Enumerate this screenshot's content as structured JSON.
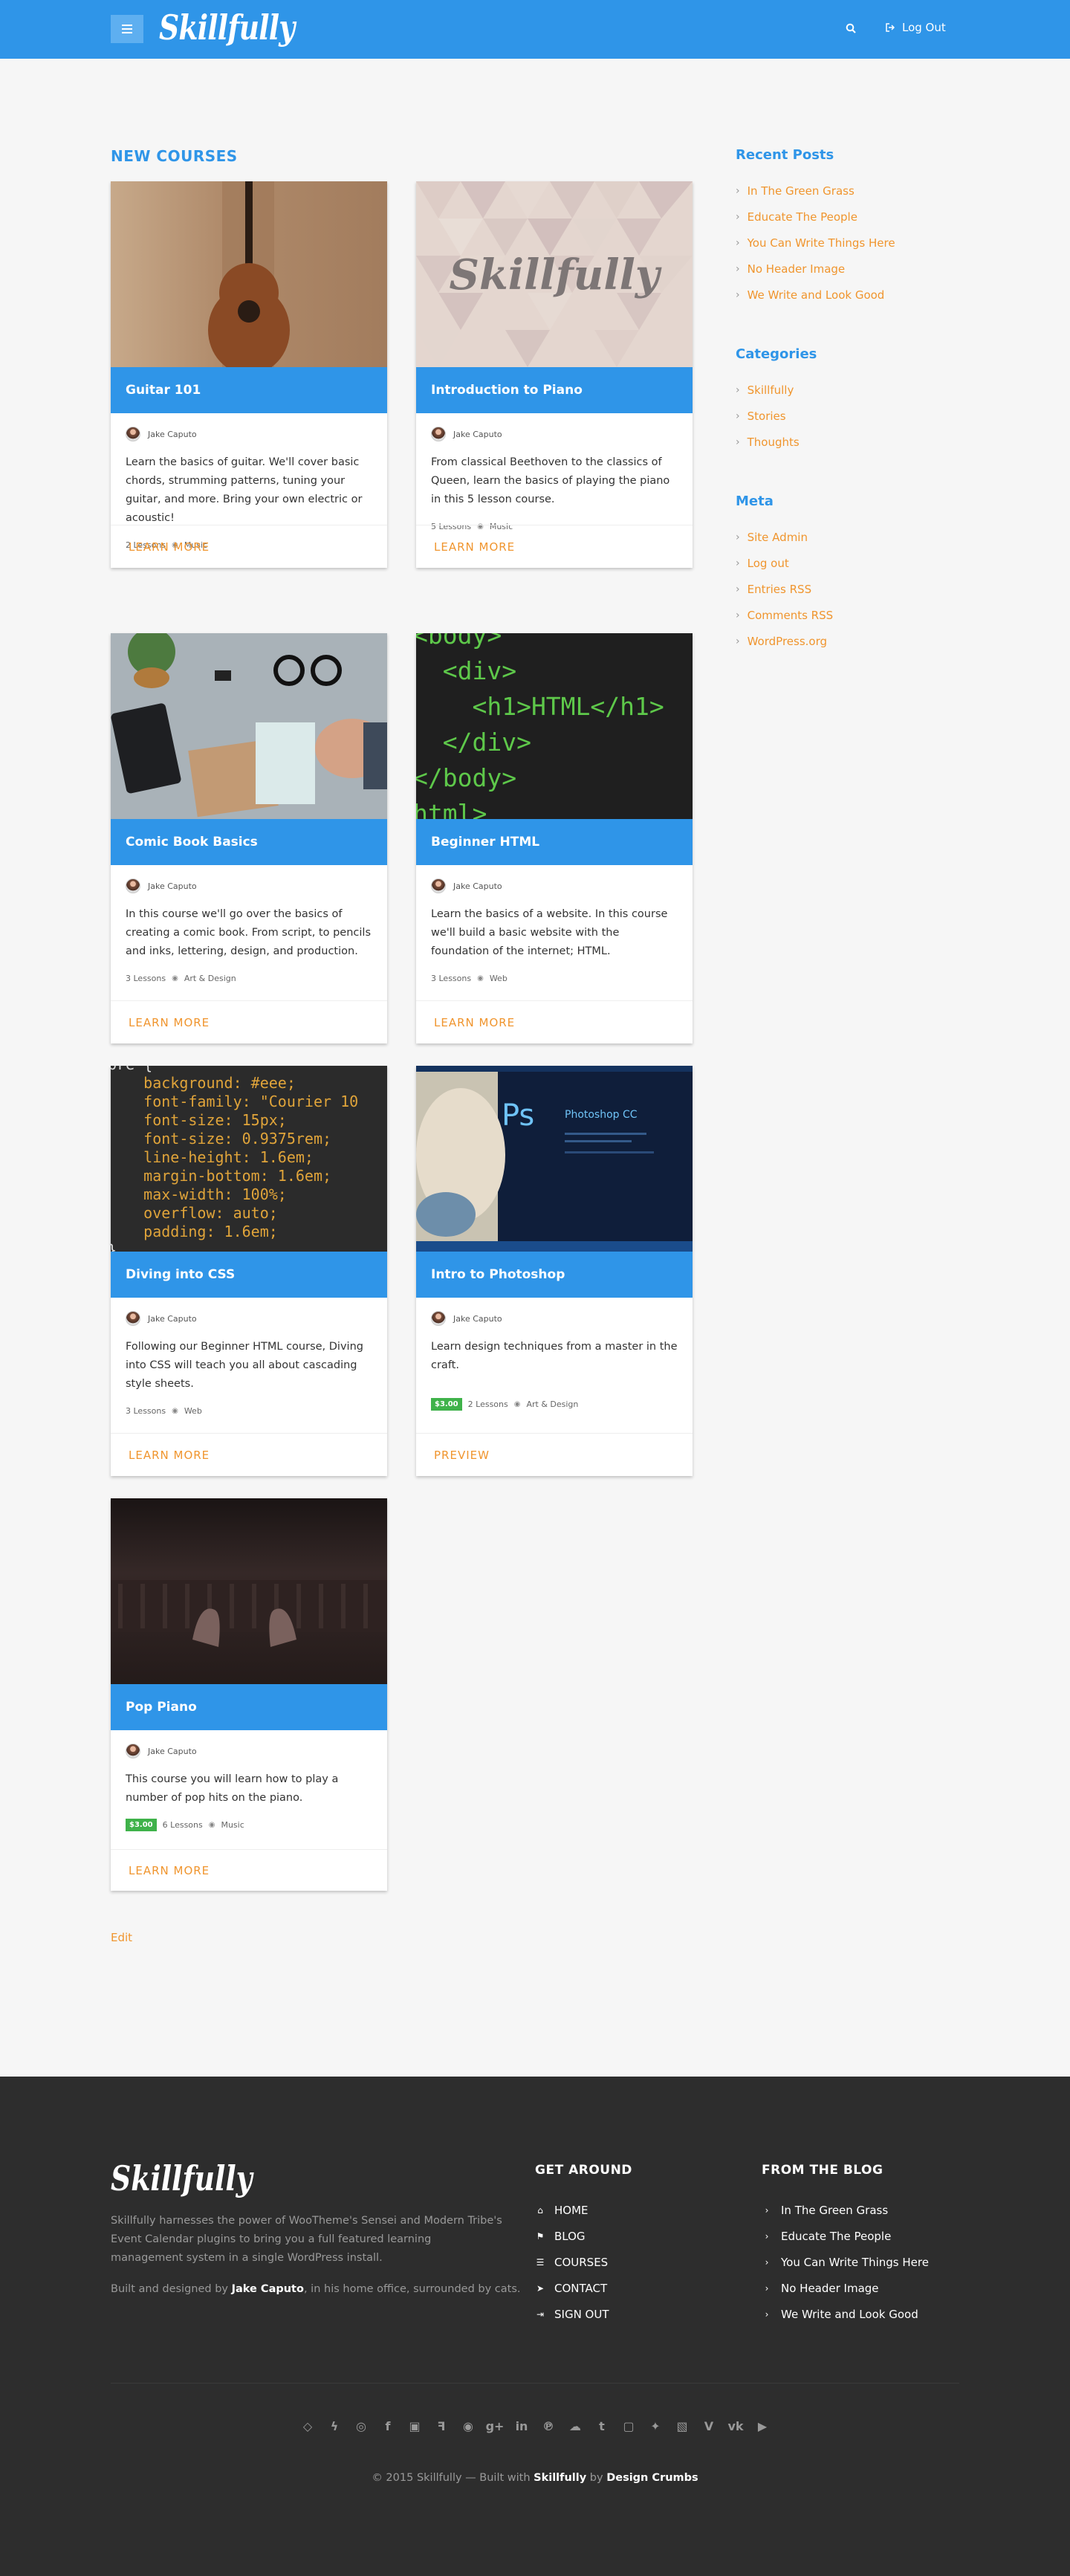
{
  "header": {
    "brand": "Skillfully",
    "logout_label": "Log Out",
    "colors": {
      "bar": "#2f95e8",
      "accent": "#f0952e"
    }
  },
  "main": {
    "section_title": "NEW COURSES",
    "cta_learn": "LEARN MORE",
    "courses": [
      {
        "title": "Guitar 101",
        "author": "Jake Caputo",
        "description": "Learn the basics of guitar. We'll cover basic chords, strumming patterns, tuning your guitar, and more. Bring your own electric or acoustic!",
        "lessons": "2 Lessons",
        "category": "Music",
        "cta": "LEARN MORE"
      },
      {
        "title": "Introduction to Piano",
        "author": "Jake Caputo",
        "description": "From classical Beethoven to the classics of Queen, learn the basics of playing the piano in this 5 lesson course.",
        "lessons": "5 Lessons",
        "category": "Music",
        "cta": "LEARN MORE"
      },
      {
        "title": "Comic Book Basics",
        "author": "Jake Caputo",
        "description": "In this course we'll go over the basics of creating a comic book. From script, to pencils and inks, lettering, design, and production.",
        "lessons": "3 Lessons",
        "category": "Art & Design",
        "cta": "LEARN MORE"
      },
      {
        "title": "Beginner HTML",
        "author": "Jake Caputo",
        "description": "Learn the basics of a website. In this course we'll build a basic website with the foundation of the internet; HTML.",
        "lessons": "3 Lessons",
        "category": "Web",
        "cta": "LEARN MORE"
      },
      {
        "title": "Diving into CSS",
        "author": "Jake Caputo",
        "description": "Following our Beginner HTML course, Diving into CSS will teach you all about cascading style sheets.",
        "lessons": "3 Lessons",
        "category": "Web",
        "cta": "LEARN MORE"
      },
      {
        "title": "Intro to Photoshop",
        "author": "Jake Caputo",
        "description": "Learn design techniques from a master in the craft.",
        "price": "$3.00",
        "lessons": "2 Lessons",
        "category": "Art & Design",
        "cta": "PREVIEW"
      },
      {
        "title": "Pop Piano",
        "author": "Jake Caputo",
        "description": "This course you will learn how to play a number of pop hits on the piano.",
        "price": "$3.00",
        "lessons": "6 Lessons",
        "category": "Music",
        "cta": "LEARN MORE"
      }
    ],
    "thumbs": {
      "piano_logo": "Skillfully",
      "html_code": [
        "<body>",
        "  <div>",
        "    <h1>HTML</h1>",
        "  </div>",
        "</body>",
        "html>"
      ],
      "css_code": [
        "pre {",
        "    background: #eee;",
        "    font-family: \"Courier 10",
        "    font-size: 15px;",
        "    font-size: 0.9375rem;",
        "    line-height: 1.6em;",
        "    margin-bottom: 1.6em;",
        "    max-width: 100%;",
        "    overflow: auto;",
        "    padding: 1.6em;",
        "}"
      ],
      "ps_badge": "Ps",
      "ps_name": "Photoshop CC"
    },
    "edit_label": "Edit"
  },
  "sidebar": {
    "recent_title": "Recent Posts",
    "recent": [
      "In The Green Grass",
      "Educate The People",
      "You Can Write Things Here",
      "No Header Image",
      "We Write and Look Good"
    ],
    "categories_title": "Categories",
    "categories": [
      "Skillfully",
      "Stories",
      "Thoughts"
    ],
    "meta_title": "Meta",
    "meta": [
      "Site Admin",
      "Log out",
      "Entries RSS",
      "Comments RSS",
      "WordPress.org"
    ]
  },
  "footer": {
    "brand": "Skillfully",
    "about": "Skillfully harnesses the power of WooTheme's Sensei and Modern Tribe's Event Calendar plugins to bring you a full featured learning management system in a single WordPress install.",
    "built_prefix": "Built and designed by",
    "built_name": "Jake Caputo",
    "built_suffix": ", in his home office, surrounded by cats.",
    "nav_title": "GET AROUND",
    "nav": [
      {
        "icon": "home-icon",
        "label": "HOME"
      },
      {
        "icon": "flag-icon",
        "label": "BLOG"
      },
      {
        "icon": "list-icon",
        "label": "COURSES"
      },
      {
        "icon": "paper-plane-icon",
        "label": "CONTACT"
      },
      {
        "icon": "sign-out-icon",
        "label": "SIGN OUT"
      }
    ],
    "blog_title": "FROM THE BLOG",
    "blog": [
      "In The Green Grass",
      "Educate The People",
      "You Can Write Things Here",
      "No Header Image",
      "We Write and Look Good"
    ],
    "social": [
      "codepen-icon",
      "deviantart-icon",
      "dribbble-icon",
      "facebook-icon",
      "flickr-icon",
      "foursquare-icon",
      "github-icon",
      "google-plus-icon",
      "linkedin-icon",
      "pinterest-icon",
      "soundcloud-icon",
      "tumblr-icon",
      "twitch-icon",
      "twitter-icon",
      "vimeo-icon",
      "vine-icon",
      "vk-icon",
      "youtube-icon"
    ],
    "copyright_prefix": "© 2015 Skillfully — Built with",
    "copyright_brand": "Skillfully",
    "copyright_by": "by",
    "copyright_author": "Design Crumbs"
  }
}
